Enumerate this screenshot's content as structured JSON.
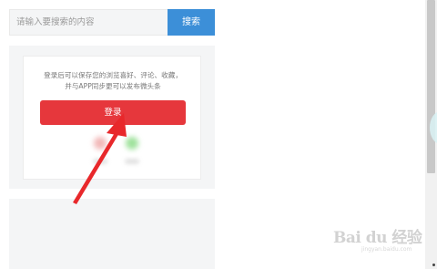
{
  "search": {
    "placeholder": "请输入要搜索的内容",
    "button_label": "搜索"
  },
  "login": {
    "description_line1": "登录后可以保存您的浏览喜好、评论、收藏，",
    "description_line2": "并与APP同步更可以发布微头条",
    "button_label": "登录",
    "social_providers": [
      {
        "icon": "blurred-social-icon",
        "color": "#f2b8b8"
      },
      {
        "icon": "wechat-icon",
        "color": "#9fe29c"
      }
    ]
  },
  "watermark": {
    "text": "Bai du 经验",
    "url": "jingyan.baidu.com"
  },
  "colors": {
    "search_button": "#3c8fd8",
    "login_button": "#e6373c",
    "arrow": "#e8282b",
    "panel_bg": "#f4f5f6"
  }
}
